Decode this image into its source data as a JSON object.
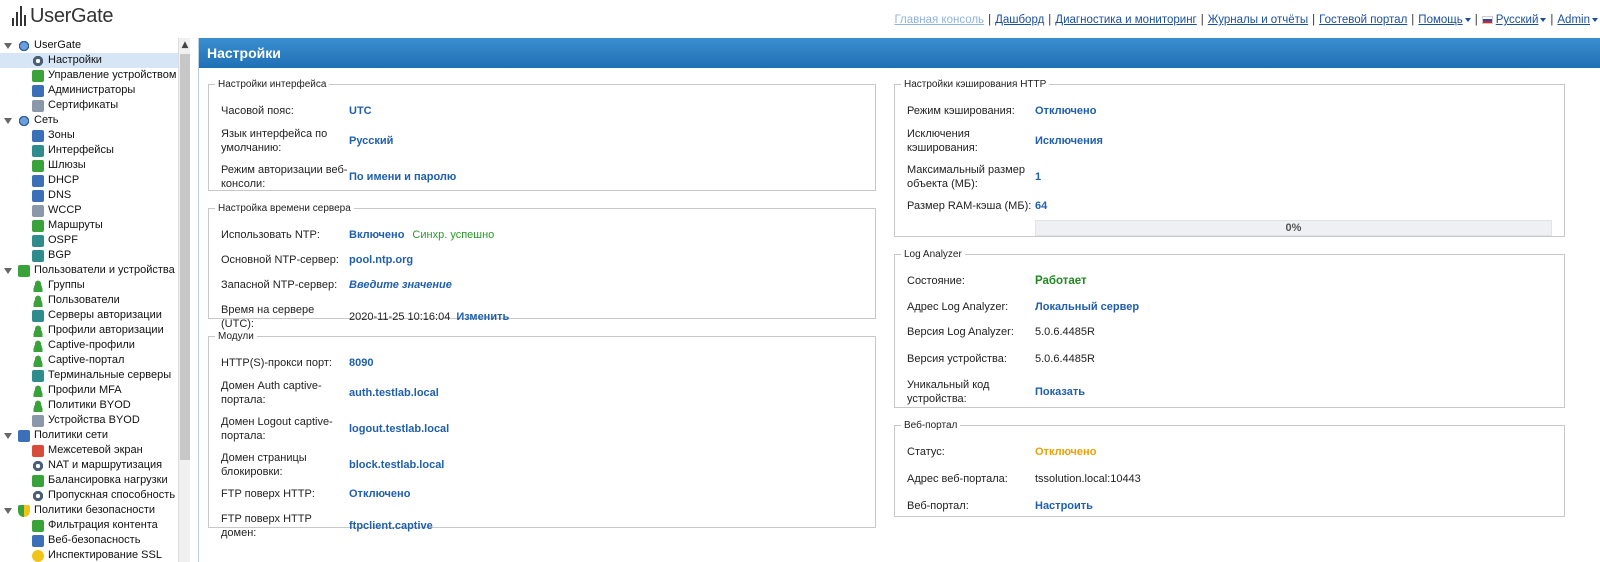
{
  "app": {
    "logo_text": "UserGate",
    "page_title": "Настройки"
  },
  "topnav": {
    "items": [
      {
        "label": "Главная консоль"
      },
      {
        "label": "Дашборд"
      },
      {
        "label": "Диагностика и мониторинг"
      },
      {
        "label": "Журналы и отчёты"
      },
      {
        "label": "Гостевой портал"
      },
      {
        "label": "Помощь"
      },
      {
        "label": "Русский"
      },
      {
        "label": "Admin"
      }
    ]
  },
  "sidebar": {
    "items": [
      {
        "label": "UserGate",
        "icon": "usergate-icon"
      },
      {
        "label": "Настройки",
        "icon": "gear-icon"
      },
      {
        "label": "Управление устройством",
        "icon": "device-icon"
      },
      {
        "label": "Администраторы",
        "icon": "admins-icon"
      },
      {
        "label": "Сертификаты",
        "icon": "certificate-icon"
      },
      {
        "label": "Сеть",
        "icon": "network-icon"
      },
      {
        "label": "Зоны",
        "icon": "zones-icon"
      },
      {
        "label": "Интерфейсы",
        "icon": "interfaces-icon"
      },
      {
        "label": "Шлюзы",
        "icon": "gateways-icon"
      },
      {
        "label": "DHCP",
        "icon": "dhcp-icon"
      },
      {
        "label": "DNS",
        "icon": "dns-icon"
      },
      {
        "label": "WCCP",
        "icon": "wccp-icon"
      },
      {
        "label": "Маршруты",
        "icon": "routes-icon"
      },
      {
        "label": "OSPF",
        "icon": "ospf-icon"
      },
      {
        "label": "BGP",
        "icon": "bgp-icon"
      },
      {
        "label": "Пользователи и устройства",
        "icon": "users-devices-icon"
      },
      {
        "label": "Группы",
        "icon": "groups-icon"
      },
      {
        "label": "Пользователи",
        "icon": "users-icon"
      },
      {
        "label": "Серверы авторизации",
        "icon": "auth-servers-icon"
      },
      {
        "label": "Профили авторизации",
        "icon": "auth-profiles-icon"
      },
      {
        "label": "Captive-профили",
        "icon": "captive-profiles-icon"
      },
      {
        "label": "Captive-портал",
        "icon": "captive-portal-icon"
      },
      {
        "label": "Терминальные серверы",
        "icon": "terminal-servers-icon"
      },
      {
        "label": "Профили MFA",
        "icon": "mfa-icon"
      },
      {
        "label": "Политики BYOD",
        "icon": "byod-policies-icon"
      },
      {
        "label": "Устройства BYOD",
        "icon": "byod-devices-icon"
      },
      {
        "label": "Политики сети",
        "icon": "network-policies-icon"
      },
      {
        "label": "Межсетевой экран",
        "icon": "firewall-icon"
      },
      {
        "label": "NAT и маршрутизация",
        "icon": "nat-icon"
      },
      {
        "label": "Балансировка нагрузки",
        "icon": "load-balancing-icon"
      },
      {
        "label": "Пропускная способность",
        "icon": "bandwidth-icon"
      },
      {
        "label": "Политики безопасности",
        "icon": "security-policies-icon"
      },
      {
        "label": "Фильтрация контента",
        "icon": "content-filter-icon"
      },
      {
        "label": "Веб-безопасность",
        "icon": "web-security-icon"
      },
      {
        "label": "Инспектирование SSL",
        "icon": "ssl-icon"
      }
    ]
  },
  "interface_settings": {
    "legend": "Настройки интерфейса",
    "timezone_label": "Часовой пояс:",
    "timezone_value": "UTC",
    "lang_label": "Язык интерфейса по умолчанию:",
    "lang_value": "Русский",
    "auth_label": "Режим авторизации веб-консоли:",
    "auth_value": "По имени и паролю"
  },
  "server_time": {
    "legend": "Настройка времени сервера",
    "ntp_label": "Использовать NTP:",
    "ntp_value": "Включено",
    "ntp_status": "Синхр. успешно",
    "primary_label": "Основной NTP-сервер:",
    "primary_value": "pool.ntp.org",
    "backup_label": "Запасной NTP-сервер:",
    "backup_value": "Введите значение",
    "time_label": "Время на сервере (UTC):",
    "time_value": "2020-11-25 10:16:04",
    "time_change": "Изменить"
  },
  "modules": {
    "legend": "Модули",
    "proxy_label": "HTTP(S)-прокси порт:",
    "proxy_value": "8090",
    "auth_domain_label": "Домен Auth captive-портала:",
    "auth_domain_value": "auth.testlab.local",
    "logout_domain_label": "Домен Logout captive-портала:",
    "logout_domain_value": "logout.testlab.local",
    "block_domain_label": "Домен страницы блокировки:",
    "block_domain_value": "block.testlab.local",
    "ftp_label": "FTP поверх HTTP:",
    "ftp_value": "Отключено",
    "ftp_domain_label": "FTP поверх HTTP домен:",
    "ftp_domain_value": "ftpclient.captive"
  },
  "http_cache": {
    "legend": "Настройки кэширования HTTP",
    "mode_label": "Режим кэширования:",
    "mode_value": "Отключено",
    "exceptions_label": "Исключения кэширования:",
    "exceptions_value": "Исключения",
    "max_size_label": "Максимальный размер объекта (МБ):",
    "max_size_value": "1",
    "ram_label": "Размер RAM-кэша (МБ):",
    "ram_value": "64",
    "progress_label": "0%",
    "progress_fraction": 0
  },
  "log_analyzer": {
    "legend": "Log Analyzer",
    "state_label": "Состояние:",
    "state_value": "Работает",
    "address_label": "Адрес Log Analyzer:",
    "address_value": "Локальный сервер",
    "version_label": "Версия Log Analyzer:",
    "version_value": "5.0.6.4485R",
    "device_version_label": "Версия устройства:",
    "device_version_value": "5.0.6.4485R",
    "unique_label": "Уникальный код устройства:",
    "unique_value": "Показать"
  },
  "web_portal": {
    "legend": "Веб-портал",
    "status_label": "Статус:",
    "status_value": "Отключено",
    "address_label": "Адрес веб-портала:",
    "address_value": "tssolution.local:10443",
    "portal_label": "Веб-портал:",
    "portal_value": "Настроить"
  }
}
